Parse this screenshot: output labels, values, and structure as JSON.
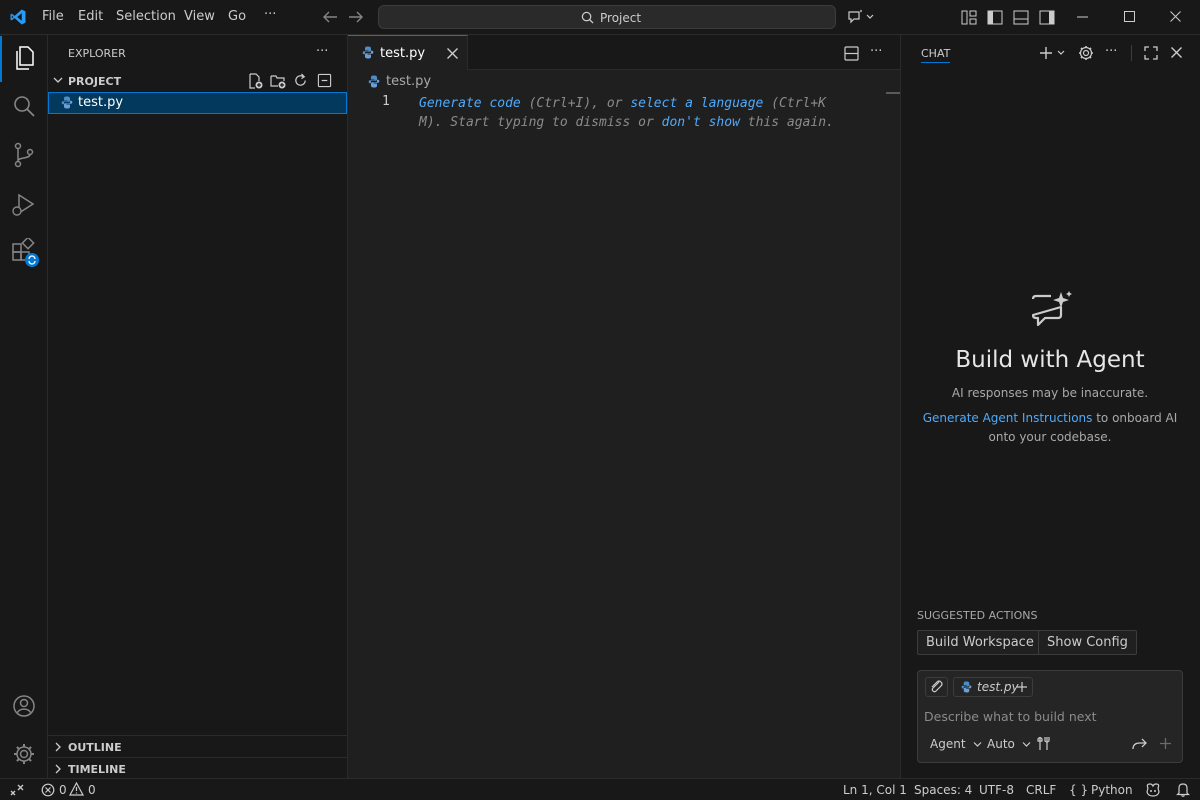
{
  "menu": {
    "file": "File",
    "edit": "Edit",
    "selection": "Selection",
    "view": "View",
    "go": "Go",
    "more": "···"
  },
  "command_center": {
    "label": "Project"
  },
  "sidebar": {
    "title": "EXPLORER",
    "more": "···",
    "folder": "PROJECT",
    "files": [
      {
        "name": "test.py"
      }
    ],
    "outline": "OUTLINE",
    "timeline": "TIMELINE"
  },
  "editor": {
    "tab": "test.py",
    "breadcrumb": "test.py",
    "line_number": "1",
    "hint": {
      "generate_code": "Generate code",
      "p1": " (Ctrl+I), or ",
      "select_language": "select a language",
      "p2": " (Ctrl+K",
      "p3": "M). Start typing to dismiss or ",
      "dont_show": "don't show",
      "p4": " this again."
    }
  },
  "chat": {
    "title": "CHAT",
    "heading": "Build with Agent",
    "disclaimer": "AI responses may be inaccurate.",
    "instructions_link": "Generate Agent Instructions",
    "instructions_text1": " to onboard AI",
    "instructions_text2": "onto your codebase.",
    "suggested_title": "SUGGESTED ACTIONS",
    "actions": [
      "Build Workspace",
      "Show Config"
    ],
    "context_file": "test.py",
    "input_placeholder": "Describe what to build next",
    "mode": "Agent",
    "model": "Auto"
  },
  "status": {
    "errors": "0",
    "warnings": "0",
    "position": "Ln 1, Col 1",
    "spaces": "Spaces: 4",
    "encoding": "UTF-8",
    "eol": "CRLF",
    "language": "Python",
    "language_braces": "{ }"
  },
  "colors": {
    "accent": "#0078d4",
    "link": "#4daafc",
    "background": "#181818",
    "editor": "#1f1f1f"
  },
  "icons": [
    "vscode-logo-icon",
    "files-icon",
    "search-icon",
    "source-control-icon",
    "run-debug-icon",
    "extensions-icon",
    "account-icon",
    "settings-gear-icon",
    "python-file-icon",
    "chat-sparkle-icon",
    "copilot-icon",
    "bell-icon"
  ]
}
